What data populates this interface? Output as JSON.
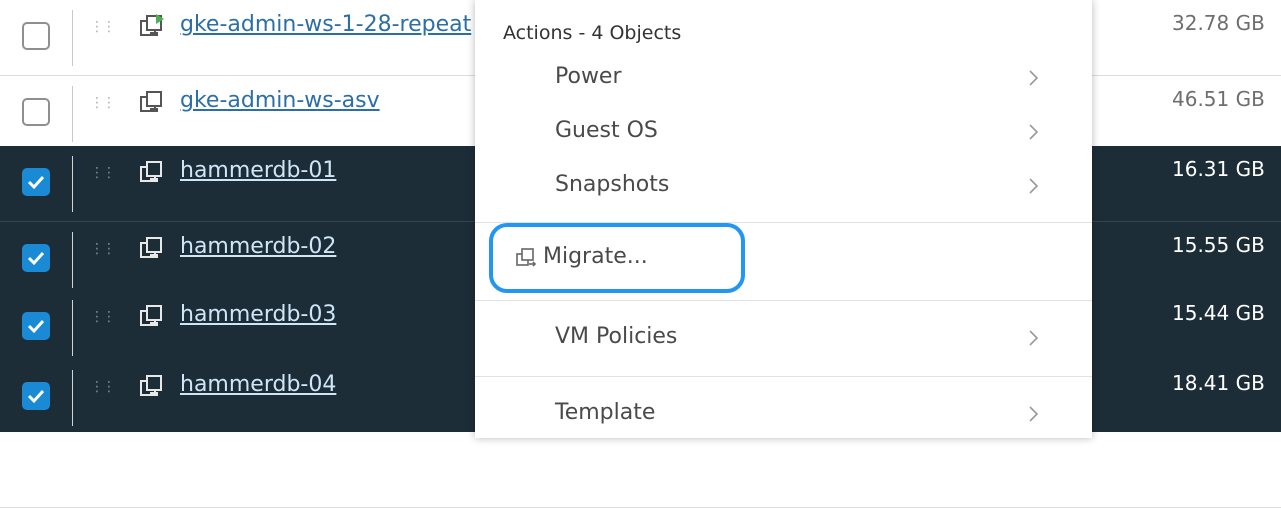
{
  "rows": [
    {
      "name": "gke-admin-ws-1-28-repeat",
      "size": "32.78 GB",
      "selected": false,
      "icon": "vm-powered-on-icon"
    },
    {
      "name": "gke-admin-ws-asv",
      "size": "46.51 GB",
      "selected": false,
      "icon": "vm-icon"
    },
    {
      "name": "hammerdb-01",
      "size": "16.31 GB",
      "selected": true,
      "icon": "vm-icon"
    },
    {
      "name": "hammerdb-02",
      "size": "15.55 GB",
      "selected": true,
      "icon": "vm-icon"
    },
    {
      "name": "hammerdb-03",
      "size": "15.44 GB",
      "selected": true,
      "icon": "vm-icon"
    },
    {
      "name": "hammerdb-04",
      "size": "18.41 GB",
      "selected": true,
      "icon": "vm-icon"
    }
  ],
  "menu": {
    "header": "Actions - 4 Objects",
    "items": [
      {
        "label": "Power",
        "submenu": true
      },
      {
        "label": "Guest OS",
        "submenu": true
      },
      {
        "label": "Snapshots",
        "submenu": true
      },
      {
        "label": "Migrate...",
        "submenu": false,
        "icon": "migrate-icon",
        "highlighted": true
      },
      {
        "label": "VM Policies",
        "submenu": true
      },
      {
        "label": "Template",
        "submenu": true
      }
    ]
  },
  "colors": {
    "selected_row": "#1d2d38",
    "link": "#2b6fa6",
    "checkbox_checked": "#1a8ad4",
    "highlight_ring": "#2196f3"
  }
}
